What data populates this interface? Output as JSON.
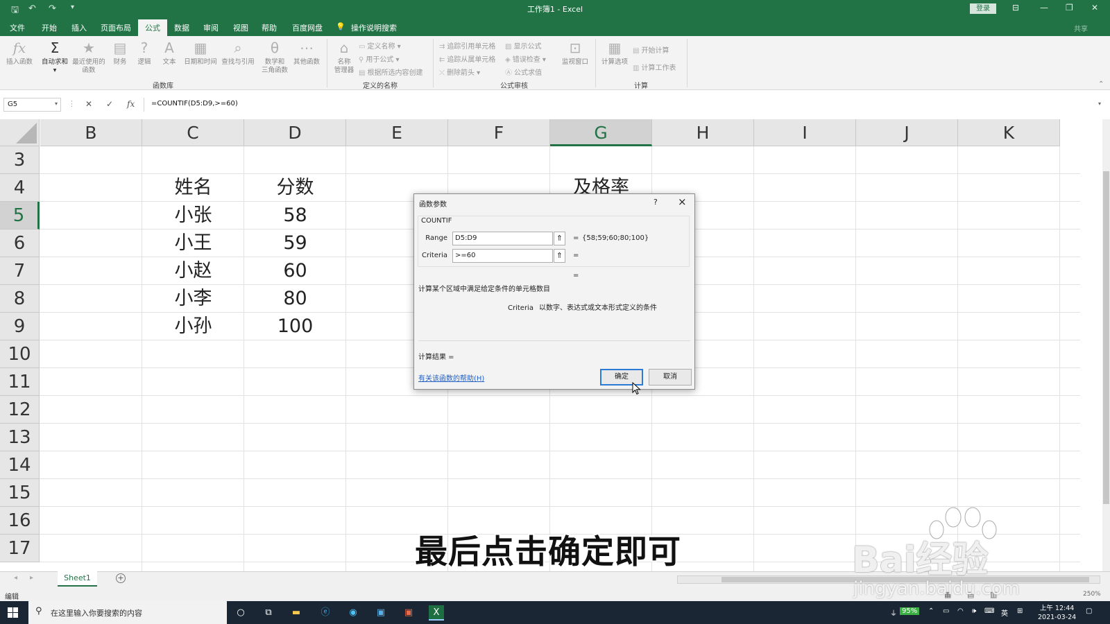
{
  "window": {
    "title": "工作簿1  -  Excel",
    "login": "登录",
    "share": "共享"
  },
  "menu": [
    "文件",
    "开始",
    "插入",
    "页面布局",
    "公式",
    "数据",
    "审阅",
    "视图",
    "帮助",
    "百度网盘"
  ],
  "menu_active": "公式",
  "tell_me": "操作说明搜索",
  "ribbon": {
    "insert_function": "插入函数",
    "autosum": "自动求和",
    "recent_l1": "最近使用的",
    "recent_l2": "函数",
    "financial": "财务",
    "logical": "逻辑",
    "text": "文本",
    "datetime": "日期和时间",
    "lookup": "查找与引用",
    "math_l1": "数学和",
    "math_l2": "三角函数",
    "other": "其他函数",
    "group_library": "函数库",
    "name_mgr_l1": "名称",
    "name_mgr_l2": "管理器",
    "define_name": "定义名称",
    "use_in_formula": "用于公式",
    "create_from_sel": "根据所选内容创建",
    "group_names": "定义的名称",
    "trace_prec": "追踪引用单元格",
    "trace_dep": "追踪从属单元格",
    "remove_arrows": "删除箭头",
    "show_formulas": "显示公式",
    "error_check": "错误检查",
    "evaluate": "公式求值",
    "watch_window": "监视窗口",
    "group_audit": "公式审核",
    "calc_options": "计算选项",
    "calc_now": "开始计算",
    "calc_sheet": "计算工作表",
    "group_calc": "计算"
  },
  "formula_bar": {
    "name_box": "G5",
    "formula": "=COUNTIF(D5:D9,>=60)",
    "fx": "fx"
  },
  "columns": [
    "B",
    "C",
    "D",
    "E",
    "F",
    "G",
    "H",
    "I",
    "J",
    "K"
  ],
  "selected_column": "G",
  "rows": [
    "3",
    "4",
    "5",
    "6",
    "7",
    "8",
    "9",
    "10",
    "11",
    "12",
    "13",
    "14",
    "15",
    "16",
    "17"
  ],
  "selected_row": "5",
  "cells": {
    "c4": "姓名",
    "d4": "分数",
    "g4": "及格率",
    "c5": "小张",
    "d5": "58",
    "c6": "小王",
    "d6": "59",
    "c7": "小赵",
    "d7": "60",
    "c8": "小李",
    "d8": "80",
    "c9": "小孙",
    "d9": "100"
  },
  "sheet": {
    "tab": "Sheet1",
    "status": "编辑",
    "zoom": "250%"
  },
  "dialog": {
    "title": "函数参数",
    "help_q": "?",
    "function": "COUNTIF",
    "range_label": "Range",
    "range_value": "D5:D9",
    "range_eval": "{58;59;60;80;100}",
    "criteria_label": "Criteria",
    "criteria_value": ">=60",
    "eq": "=",
    "description": "计算某个区域中满足给定条件的单元格数目",
    "arg_name": "Criteria",
    "arg_desc": "以数字、表达式或文本形式定义的条件",
    "result_label": "计算结果 =",
    "help_link": "有关该函数的帮助(H)",
    "ok": "确定",
    "cancel": "取消"
  },
  "subtitle": "最后点击确定即可",
  "watermark": {
    "brand": "Bai经验",
    "url": "jingyan.baidu.com"
  },
  "taskbar": {
    "search_placeholder": "在这里输入你要搜索的内容",
    "battery": "95%",
    "ime": "英",
    "time": "上午 12:44",
    "date": "2021-03-24"
  }
}
